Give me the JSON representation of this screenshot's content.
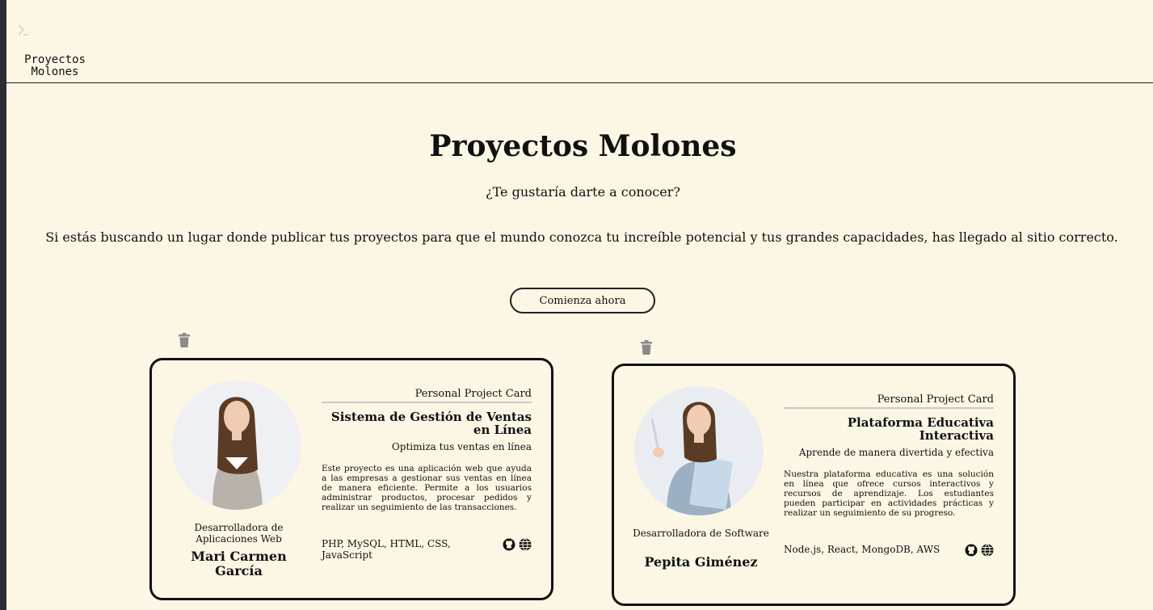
{
  "header": {
    "logo_text": "Proyectos Molones"
  },
  "hero": {
    "title": "Proyectos Molones",
    "subtitle": "¿Te gustaría darte a conocer?",
    "text": "Si estás buscando un lugar donde publicar tus proyectos para que el mundo conozca tu increíble potencial y tus grandes capacidades, has llegado al sitio correcto.",
    "cta_label": "Comienza ahora"
  },
  "cards": [
    {
      "label": "Personal Project Card",
      "title": "Sistema de Gestión de Ventas en Línea",
      "slogan": "Optimiza tus ventas en línea",
      "description": "Este proyecto es una aplicación web que ayuda a las empresas a gestionar sus ventas en línea de manera eficiente. Permite a los usuarios administrar productos, procesar pedidos y realizar un seguimiento de las transacciones.",
      "technologies": "PHP, MySQL, HTML, CSS, JavaScript",
      "author_role": "Desarrolladora de Aplicaciones Web",
      "author_name": "Mari Carmen García",
      "icons": [
        "github-icon",
        "globe-icon"
      ]
    },
    {
      "label": "Personal Project Card",
      "title": "Plataforma Educativa Interactiva",
      "slogan": "Aprende de manera divertida y efectiva",
      "description": "Nuestra plataforma educativa es una solución en línea que ofrece cursos interactivos y recursos de aprendizaje. Los estudiantes pueden participar en actividades prácticas y realizar un seguimiento de su progreso.",
      "technologies": "Node.js, React, MongoDB, AWS",
      "author_role": "Desarrolladora de Software",
      "author_name": "Pepita Giménez",
      "icons": [
        "github-icon",
        "globe-icon"
      ]
    }
  ],
  "colors": {
    "background": "#fcf6e4",
    "border": "#111111",
    "trash": "#8a8a8a"
  }
}
